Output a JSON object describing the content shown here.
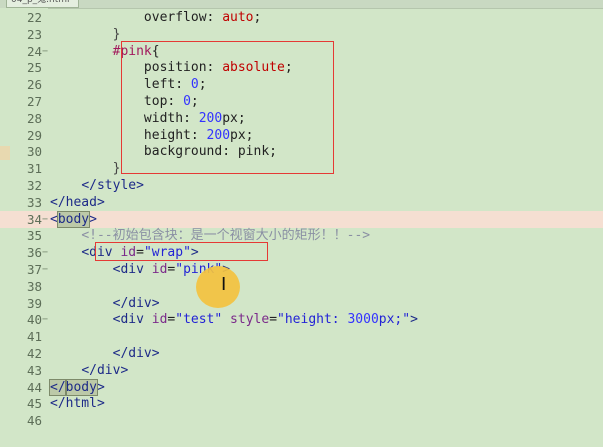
{
  "tab": {
    "title": "04_p_鬼.html"
  },
  "lines": [
    {
      "n": "22",
      "fold": "",
      "html": "            <span class=\"pr\">overflow</span>: <span class=\"vl\">auto</span>;"
    },
    {
      "n": "23",
      "fold": "",
      "html": "        <span class=\"br\">}</span>"
    },
    {
      "n": "24",
      "fold": "−",
      "html": "        <span class=\"sel\">#pink</span>{"
    },
    {
      "n": "25",
      "fold": "",
      "html": "            <span class=\"pr\">position</span>: <span class=\"vl\">absolute</span>;"
    },
    {
      "n": "26",
      "fold": "",
      "html": "            <span class=\"pr\">left</span>: <span class=\"nm\">0</span>;"
    },
    {
      "n": "27",
      "fold": "",
      "html": "            <span class=\"pr\">top</span>: <span class=\"nm\">0</span>;"
    },
    {
      "n": "28",
      "fold": "",
      "html": "            <span class=\"pr\">width</span>: <span class=\"nm\">200</span>px;"
    },
    {
      "n": "29",
      "fold": "",
      "html": "            <span class=\"pr\">height</span>: <span class=\"nm\">200</span>px;"
    },
    {
      "n": "30",
      "fold": "",
      "html": "            <span class=\"pr\">background</span>: pink;"
    },
    {
      "n": "31",
      "fold": "",
      "html": "        <span class=\"br\">}</span>"
    },
    {
      "n": "32",
      "fold": "",
      "html": "    <span class=\"tg\">&lt;/style&gt;</span>"
    },
    {
      "n": "33",
      "fold": "",
      "html": "<span class=\"tg\">&lt;/head&gt;</span>"
    },
    {
      "n": "34",
      "fold": "−",
      "hl": true,
      "html": "<span class=\"tg\">&lt;<span class=\"mbox\">body</span>&gt;</span>"
    },
    {
      "n": "35",
      "fold": "",
      "html": "    <span class=\"cm\">&lt;!--初始包含块：是一个视窗大小的矩形！！--&gt;</span>"
    },
    {
      "n": "36",
      "fold": "−",
      "html": "    <span class=\"tg\">&lt;div</span> <span class=\"an\">id</span>=<span class=\"av\">\"wrap\"</span><span class=\"tg\">&gt;</span>"
    },
    {
      "n": "37",
      "fold": "−",
      "html": "        <span class=\"tg\">&lt;div</span> <span class=\"an\">id</span>=<span class=\"av\">\"pink\"</span><span class=\"tg\">&gt;</span>"
    },
    {
      "n": "38",
      "fold": "",
      "html": ""
    },
    {
      "n": "39",
      "fold": "",
      "html": "        <span class=\"tg\">&lt;/div&gt;</span>"
    },
    {
      "n": "40",
      "fold": "−",
      "html": "        <span class=\"tg\">&lt;div</span> <span class=\"an\">id</span>=<span class=\"av\">\"test\"</span> <span class=\"an\">style</span>=<span class=\"av\">\"height: <span class=\"nm\">3000</span>px;\"</span><span class=\"tg\">&gt;</span>"
    },
    {
      "n": "41",
      "fold": "",
      "html": ""
    },
    {
      "n": "42",
      "fold": "",
      "html": "        <span class=\"tg\">&lt;/div&gt;</span>"
    },
    {
      "n": "43",
      "fold": "",
      "html": "    <span class=\"tg\">&lt;/div&gt;</span>"
    },
    {
      "n": "44",
      "fold": "",
      "html": "<span class=\"tg\"><span class=\"mbox\">&lt;/</span><span class=\"mbox\">body</span>&gt;</span>"
    },
    {
      "n": "45",
      "fold": "",
      "html": "<span class=\"tg\">&lt;/html&gt;</span>"
    },
    {
      "n": "46",
      "fold": "",
      "html": ""
    }
  ]
}
